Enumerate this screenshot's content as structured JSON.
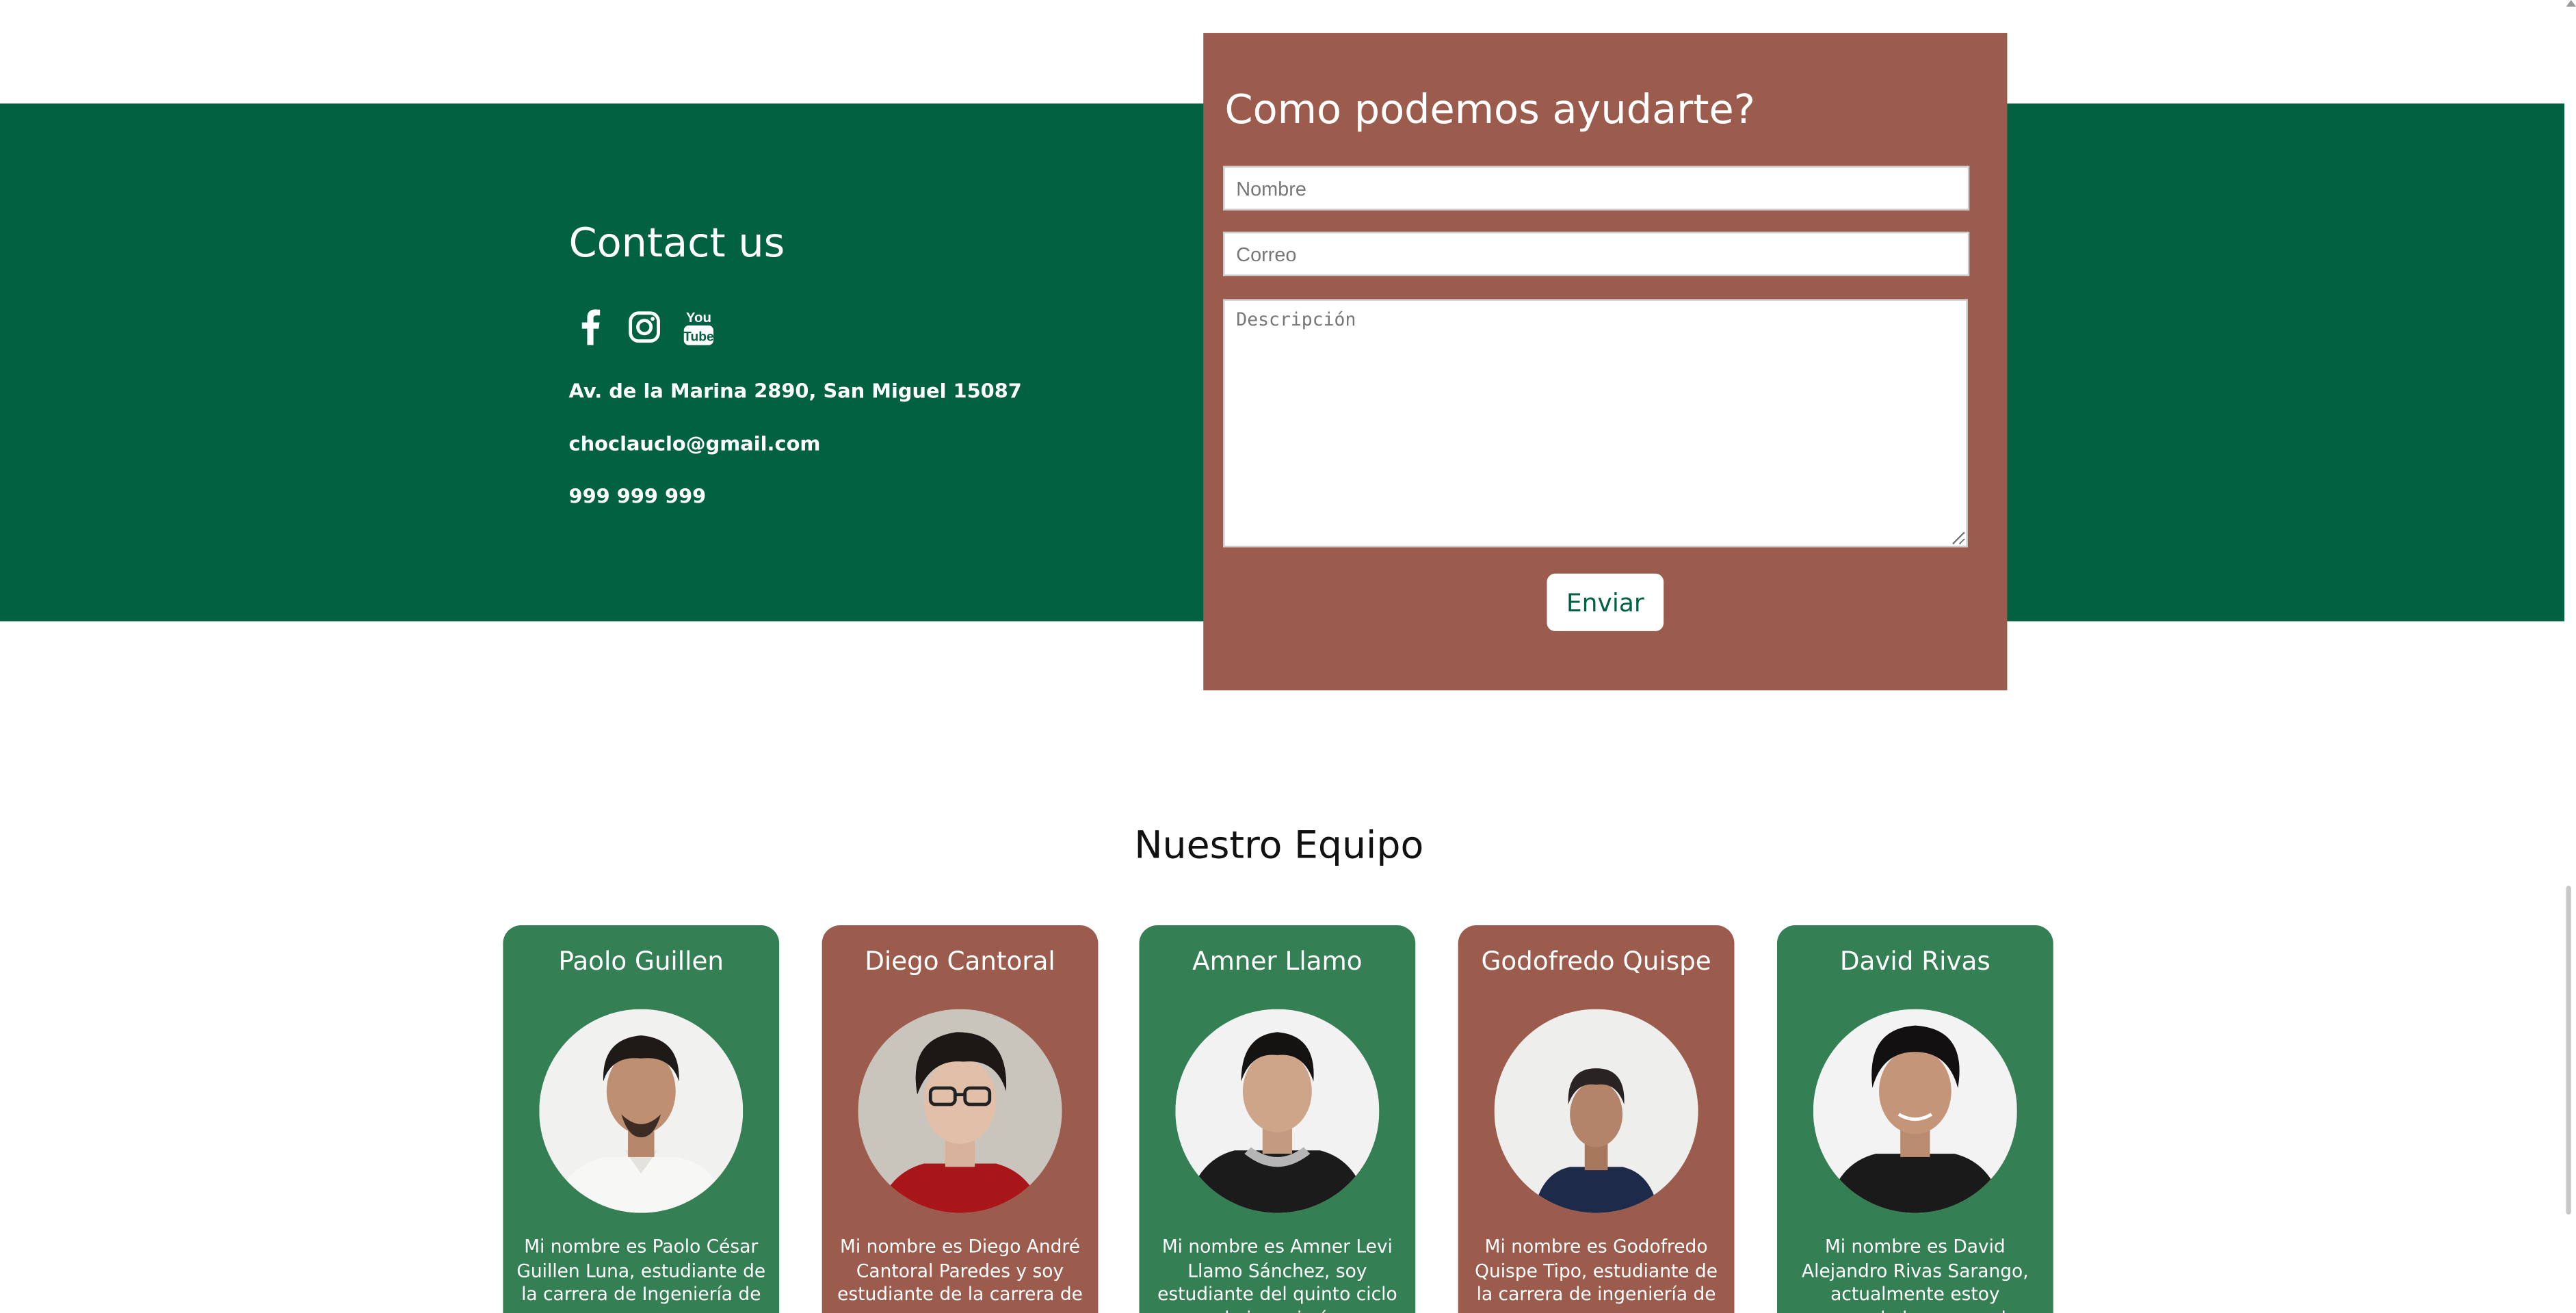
{
  "colors": {
    "contact_band": "#016141",
    "form_panel": "#9b5c4d",
    "card_green": "#357f54",
    "card_brown": "#9b5c4d",
    "button_text": "#016141"
  },
  "contact": {
    "title": "Contact us",
    "social": [
      {
        "name": "facebook-icon"
      },
      {
        "name": "instagram-icon"
      },
      {
        "name": "youtube-icon",
        "line1": "You",
        "line2": "Tube"
      }
    ],
    "address": "Av. de la Marina 2890, San Miguel 15087",
    "email": "choclauclo@gmail.com",
    "phone": "999 999 999"
  },
  "form": {
    "title": "Como podemos ayudarte?",
    "name_placeholder": "Nombre",
    "email_placeholder": "Correo",
    "description_placeholder": "Descripción",
    "submit_label": "Enviar"
  },
  "team": {
    "title": "Nuestro Equipo",
    "members": [
      {
        "name": "Paolo Guillen",
        "color": "green",
        "bio": "Mi nombre es Paolo César Guillen Luna, estudiante de la carrera de Ingeniería de"
      },
      {
        "name": "Diego Cantoral",
        "color": "brown",
        "bio": "Mi nombre es Diego André Cantoral Paredes y soy estudiante de la carrera de"
      },
      {
        "name": "Amner Llamo",
        "color": "green",
        "bio": "Mi nombre es Amner Levi Llamo Sánchez, soy estudiante del quinto ciclo de ingeniería"
      },
      {
        "name": "Godofredo Quispe",
        "color": "brown",
        "bio": "Mi nombre es Godofredo Quispe Tipo, estudiante de la carrera de ingeniería de"
      },
      {
        "name": "David Rivas",
        "color": "green",
        "bio": "Mi nombre es David Alejandro Rivas Sarango, actualmente estoy cursando la carrera de"
      }
    ]
  }
}
